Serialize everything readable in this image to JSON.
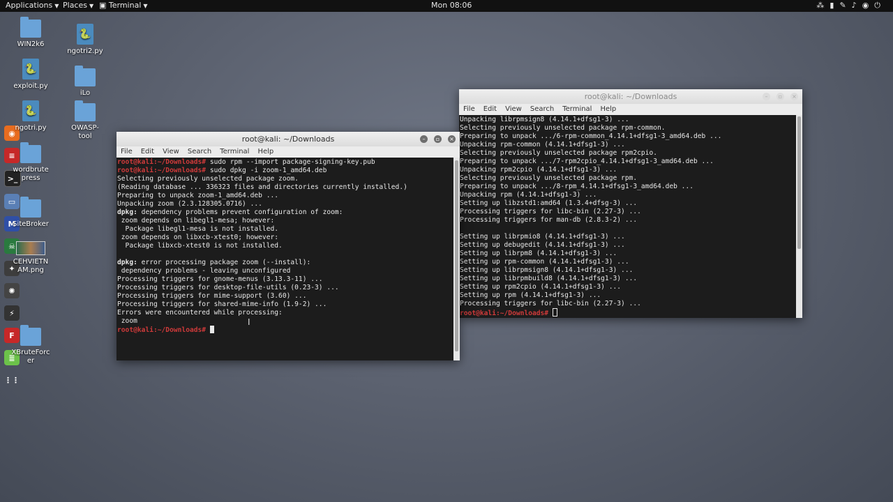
{
  "topbar": {
    "applications": "Applications",
    "places": "Places",
    "terminal": "Terminal",
    "clock": "Mon 08:06",
    "indicators": [
      "network-icon",
      "window-icon",
      "pen-icon",
      "volume-icon",
      "battery-icon",
      "power-icon"
    ]
  },
  "desktop_icons": [
    {
      "label": "WIN2k6",
      "kind": "folder"
    },
    {
      "label": "ngotri2.py",
      "kind": "python"
    },
    {
      "label": "exploit.py",
      "kind": "python"
    },
    {
      "label": "iLo",
      "kind": "folder"
    },
    {
      "label": "ngotri.py",
      "kind": "python"
    },
    {
      "label": "OWASP-tool",
      "kind": "folder"
    },
    {
      "label": "wordbrutepress",
      "kind": "folder"
    },
    {
      "label": "SiteBroker",
      "kind": "folder"
    },
    {
      "label": "CEHVIETNAM.png",
      "kind": "image"
    },
    {
      "label": "XBruteForcer",
      "kind": "folder"
    }
  ],
  "win1": {
    "title": "root@kali: ~/Downloads",
    "menu": [
      "File",
      "Edit",
      "View",
      "Search",
      "Terminal",
      "Help"
    ],
    "prompt": "root@kali:~/Downloads#",
    "lines": [
      {
        "p": true,
        "t": " sudo rpm --import package-signing-key.pub"
      },
      {
        "p": true,
        "t": " sudo dpkg -i zoom-1_amd64.deb"
      },
      {
        "t": "Selecting previously unselected package zoom."
      },
      {
        "t": "(Reading database ... 336323 files and directories currently installed.)"
      },
      {
        "t": "Preparing to unpack zoom-1_amd64.deb ..."
      },
      {
        "t": "Unpacking zoom (2.3.128305.0716) ..."
      },
      {
        "b": "dpkg:",
        "t": " dependency problems prevent configuration of zoom:"
      },
      {
        "t": " zoom depends on libegl1-mesa; however:"
      },
      {
        "t": "  Package libegl1-mesa is not installed."
      },
      {
        "t": " zoom depends on libxcb-xtest0; however:"
      },
      {
        "t": "  Package libxcb-xtest0 is not installed."
      },
      {
        "t": ""
      },
      {
        "b": "dpkg:",
        "t": " error processing package zoom (--install):"
      },
      {
        "t": " dependency problems - leaving unconfigured"
      },
      {
        "t": "Processing triggers for gnome-menus (3.13.3-11) ..."
      },
      {
        "t": "Processing triggers for desktop-file-utils (0.23-3) ..."
      },
      {
        "t": "Processing triggers for mime-support (3.60) ..."
      },
      {
        "t": "Processing triggers for shared-mime-info (1.9-2) ..."
      },
      {
        "t": "Errors were encountered while processing:"
      },
      {
        "t": " zoom"
      },
      {
        "p": true,
        "t": " ",
        "cursor": true
      }
    ]
  },
  "win2": {
    "title": "root@kali: ~/Downloads",
    "menu": [
      "File",
      "Edit",
      "View",
      "Search",
      "Terminal",
      "Help"
    ],
    "prompt": "root@kali:~/Downloads#",
    "lines": [
      {
        "t": "Unpacking librpmsign8 (4.14.1+dfsg1-3) ..."
      },
      {
        "t": "Selecting previously unselected package rpm-common."
      },
      {
        "t": "Preparing to unpack .../6-rpm-common_4.14.1+dfsg1-3_amd64.deb ..."
      },
      {
        "t": "Unpacking rpm-common (4.14.1+dfsg1-3) ..."
      },
      {
        "t": "Selecting previously unselected package rpm2cpio."
      },
      {
        "t": "Preparing to unpack .../7-rpm2cpio_4.14.1+dfsg1-3_amd64.deb ..."
      },
      {
        "t": "Unpacking rpm2cpio (4.14.1+dfsg1-3) ..."
      },
      {
        "t": "Selecting previously unselected package rpm."
      },
      {
        "t": "Preparing to unpack .../8-rpm_4.14.1+dfsg1-3_amd64.deb ..."
      },
      {
        "t": "Unpacking rpm (4.14.1+dfsg1-3) ..."
      },
      {
        "t": "Setting up libzstd1:amd64 (1.3.4+dfsg-3) ..."
      },
      {
        "t": "Processing triggers for libc-bin (2.27-3) ..."
      },
      {
        "t": "Processing triggers for man-db (2.8.3-2) ..."
      },
      {
        "t": ""
      },
      {
        "t": "Setting up librpmio8 (4.14.1+dfsg1-3) ..."
      },
      {
        "t": "Setting up debugedit (4.14.1+dfsg1-3) ..."
      },
      {
        "t": "Setting up librpm8 (4.14.1+dfsg1-3) ..."
      },
      {
        "t": "Setting up rpm-common (4.14.1+dfsg1-3) ..."
      },
      {
        "t": "Setting up librpmsign8 (4.14.1+dfsg1-3) ..."
      },
      {
        "t": "Setting up librpmbuild8 (4.14.1+dfsg1-3) ..."
      },
      {
        "t": "Setting up rpm2cpio (4.14.1+dfsg1-3) ..."
      },
      {
        "t": "Setting up rpm (4.14.1+dfsg1-3) ..."
      },
      {
        "t": "Processing triggers for libc-bin (2.27-3) ..."
      },
      {
        "p": true,
        "t": " ",
        "cursor": true,
        "hollow": true
      }
    ]
  },
  "colors": {
    "prompt": "#cf3a3a",
    "terminal_bg": "#1c1c1c",
    "folder": "#6aa3d8"
  }
}
